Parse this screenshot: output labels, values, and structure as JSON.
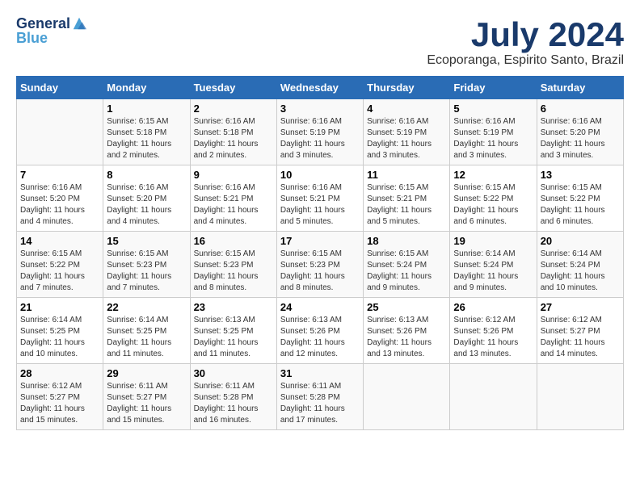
{
  "header": {
    "logo_line1": "General",
    "logo_line2": "Blue",
    "month": "July 2024",
    "location": "Ecoporanga, Espirito Santo, Brazil"
  },
  "days_of_week": [
    "Sunday",
    "Monday",
    "Tuesday",
    "Wednesday",
    "Thursday",
    "Friday",
    "Saturday"
  ],
  "weeks": [
    [
      {
        "day": "",
        "info": ""
      },
      {
        "day": "1",
        "info": "Sunrise: 6:15 AM\nSunset: 5:18 PM\nDaylight: 11 hours\nand 2 minutes."
      },
      {
        "day": "2",
        "info": "Sunrise: 6:16 AM\nSunset: 5:18 PM\nDaylight: 11 hours\nand 2 minutes."
      },
      {
        "day": "3",
        "info": "Sunrise: 6:16 AM\nSunset: 5:19 PM\nDaylight: 11 hours\nand 3 minutes."
      },
      {
        "day": "4",
        "info": "Sunrise: 6:16 AM\nSunset: 5:19 PM\nDaylight: 11 hours\nand 3 minutes."
      },
      {
        "day": "5",
        "info": "Sunrise: 6:16 AM\nSunset: 5:19 PM\nDaylight: 11 hours\nand 3 minutes."
      },
      {
        "day": "6",
        "info": "Sunrise: 6:16 AM\nSunset: 5:20 PM\nDaylight: 11 hours\nand 3 minutes."
      }
    ],
    [
      {
        "day": "7",
        "info": "Sunrise: 6:16 AM\nSunset: 5:20 PM\nDaylight: 11 hours\nand 4 minutes."
      },
      {
        "day": "8",
        "info": "Sunrise: 6:16 AM\nSunset: 5:20 PM\nDaylight: 11 hours\nand 4 minutes."
      },
      {
        "day": "9",
        "info": "Sunrise: 6:16 AM\nSunset: 5:21 PM\nDaylight: 11 hours\nand 4 minutes."
      },
      {
        "day": "10",
        "info": "Sunrise: 6:16 AM\nSunset: 5:21 PM\nDaylight: 11 hours\nand 5 minutes."
      },
      {
        "day": "11",
        "info": "Sunrise: 6:15 AM\nSunset: 5:21 PM\nDaylight: 11 hours\nand 5 minutes."
      },
      {
        "day": "12",
        "info": "Sunrise: 6:15 AM\nSunset: 5:22 PM\nDaylight: 11 hours\nand 6 minutes."
      },
      {
        "day": "13",
        "info": "Sunrise: 6:15 AM\nSunset: 5:22 PM\nDaylight: 11 hours\nand 6 minutes."
      }
    ],
    [
      {
        "day": "14",
        "info": "Sunrise: 6:15 AM\nSunset: 5:22 PM\nDaylight: 11 hours\nand 7 minutes."
      },
      {
        "day": "15",
        "info": "Sunrise: 6:15 AM\nSunset: 5:23 PM\nDaylight: 11 hours\nand 7 minutes."
      },
      {
        "day": "16",
        "info": "Sunrise: 6:15 AM\nSunset: 5:23 PM\nDaylight: 11 hours\nand 8 minutes."
      },
      {
        "day": "17",
        "info": "Sunrise: 6:15 AM\nSunset: 5:23 PM\nDaylight: 11 hours\nand 8 minutes."
      },
      {
        "day": "18",
        "info": "Sunrise: 6:15 AM\nSunset: 5:24 PM\nDaylight: 11 hours\nand 9 minutes."
      },
      {
        "day": "19",
        "info": "Sunrise: 6:14 AM\nSunset: 5:24 PM\nDaylight: 11 hours\nand 9 minutes."
      },
      {
        "day": "20",
        "info": "Sunrise: 6:14 AM\nSunset: 5:24 PM\nDaylight: 11 hours\nand 10 minutes."
      }
    ],
    [
      {
        "day": "21",
        "info": "Sunrise: 6:14 AM\nSunset: 5:25 PM\nDaylight: 11 hours\nand 10 minutes."
      },
      {
        "day": "22",
        "info": "Sunrise: 6:14 AM\nSunset: 5:25 PM\nDaylight: 11 hours\nand 11 minutes."
      },
      {
        "day": "23",
        "info": "Sunrise: 6:13 AM\nSunset: 5:25 PM\nDaylight: 11 hours\nand 11 minutes."
      },
      {
        "day": "24",
        "info": "Sunrise: 6:13 AM\nSunset: 5:26 PM\nDaylight: 11 hours\nand 12 minutes."
      },
      {
        "day": "25",
        "info": "Sunrise: 6:13 AM\nSunset: 5:26 PM\nDaylight: 11 hours\nand 13 minutes."
      },
      {
        "day": "26",
        "info": "Sunrise: 6:12 AM\nSunset: 5:26 PM\nDaylight: 11 hours\nand 13 minutes."
      },
      {
        "day": "27",
        "info": "Sunrise: 6:12 AM\nSunset: 5:27 PM\nDaylight: 11 hours\nand 14 minutes."
      }
    ],
    [
      {
        "day": "28",
        "info": "Sunrise: 6:12 AM\nSunset: 5:27 PM\nDaylight: 11 hours\nand 15 minutes."
      },
      {
        "day": "29",
        "info": "Sunrise: 6:11 AM\nSunset: 5:27 PM\nDaylight: 11 hours\nand 15 minutes."
      },
      {
        "day": "30",
        "info": "Sunrise: 6:11 AM\nSunset: 5:28 PM\nDaylight: 11 hours\nand 16 minutes."
      },
      {
        "day": "31",
        "info": "Sunrise: 6:11 AM\nSunset: 5:28 PM\nDaylight: 11 hours\nand 17 minutes."
      },
      {
        "day": "",
        "info": ""
      },
      {
        "day": "",
        "info": ""
      },
      {
        "day": "",
        "info": ""
      }
    ]
  ]
}
